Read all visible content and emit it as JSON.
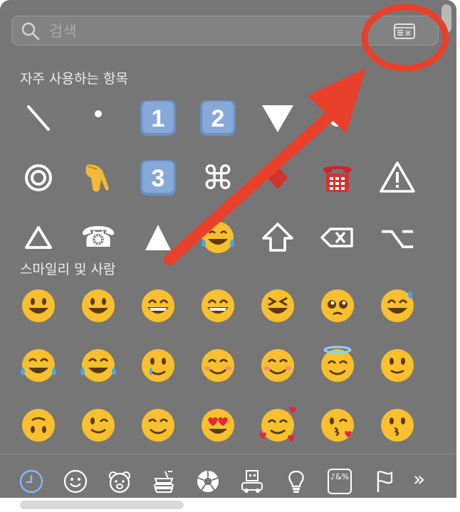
{
  "search": {
    "placeholder": "검색"
  },
  "sections": {
    "frequent_title": "자주 사용하는 항목",
    "smileys_title": "스마일리 및 사람"
  },
  "frequent": [
    {
      "name": "diagonal-line",
      "label": "diagonal line"
    },
    {
      "name": "small-dot",
      "label": "small dot"
    },
    {
      "name": "keycap-1",
      "label": "1"
    },
    {
      "name": "keycap-2",
      "label": "2"
    },
    {
      "name": "down-triangle",
      "label": "down triangle"
    },
    {
      "name": "black-circle",
      "label": "black circle"
    },
    {
      "name": "bullseye-circle",
      "label": "double circle"
    },
    {
      "name": "pointing-hand",
      "label": "pointing hand"
    },
    {
      "name": "keycap-3",
      "label": "3"
    },
    {
      "name": "command-key",
      "label": "⌘"
    },
    {
      "name": "red-diamond",
      "label": "red diamond"
    },
    {
      "name": "telephone",
      "label": "telephone"
    },
    {
      "name": "warning-sign",
      "label": "warning"
    },
    {
      "name": "up-triangle-outline",
      "label": "up triangle outline"
    },
    {
      "name": "telephone-glyph",
      "label": "☎"
    },
    {
      "name": "up-triangle-solid",
      "label": "up triangle"
    },
    {
      "name": "face-tears-joy",
      "label": "tears of joy"
    },
    {
      "name": "shift-arrow",
      "label": "shift"
    },
    {
      "name": "delete-key",
      "label": "delete"
    },
    {
      "name": "option-key",
      "label": "⌥"
    }
  ],
  "smileys": [
    {
      "name": "grinning-face"
    },
    {
      "name": "grinning-big-eyes"
    },
    {
      "name": "grinning-smiling-eyes"
    },
    {
      "name": "beaming-face"
    },
    {
      "name": "squinting-face"
    },
    {
      "name": "holding-back-tears"
    },
    {
      "name": "grinning-sweat"
    },
    {
      "name": "face-tears-joy"
    },
    {
      "name": "rolling-laughing"
    },
    {
      "name": "smiling-tear"
    },
    {
      "name": "smiling-face"
    },
    {
      "name": "smiling-eyes"
    },
    {
      "name": "halo-face"
    },
    {
      "name": "slight-smile"
    },
    {
      "name": "upside-down"
    },
    {
      "name": "winking-face"
    },
    {
      "name": "relieved-face"
    },
    {
      "name": "heart-eyes"
    },
    {
      "name": "smiling-hearts"
    },
    {
      "name": "kissing-heart"
    },
    {
      "name": "kissing-face"
    }
  ],
  "categories": [
    {
      "name": "recent-icon",
      "active": true
    },
    {
      "name": "smiley-icon"
    },
    {
      "name": "animal-icon"
    },
    {
      "name": "food-icon"
    },
    {
      "name": "ball-icon"
    },
    {
      "name": "building-icon"
    },
    {
      "name": "lightbulb-icon"
    },
    {
      "name": "symbols-icon",
      "label": "♪&%"
    },
    {
      "name": "flag-icon"
    },
    {
      "name": "more-icon",
      "label": "»"
    }
  ],
  "colors": {
    "panel": "#767676",
    "annotation_red": "#e8402b",
    "emoji_yellow": "#f8c02e"
  }
}
